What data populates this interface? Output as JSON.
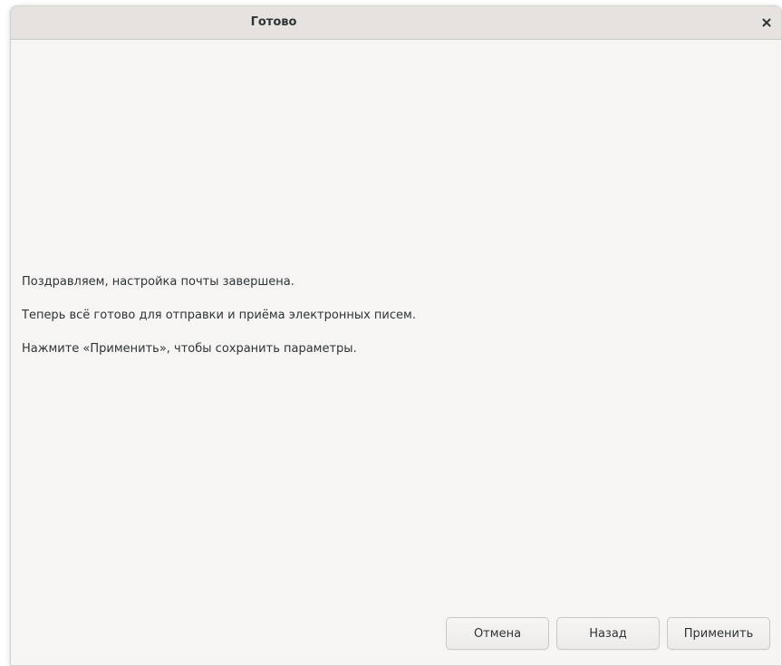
{
  "window": {
    "title": "Готово",
    "close_icon": "close-icon"
  },
  "content": {
    "line1": "Поздравляем, настройка почты завершена.",
    "line2": "Теперь всё готово для отправки и приёма электронных писем.",
    "line3": "Нажмите «Применить», чтобы сохранить параметры."
  },
  "buttons": {
    "cancel_label": "Отмена",
    "back_label": "Назад",
    "apply_label": "Применить"
  },
  "colors": {
    "background": "#f6f5f4",
    "titlebar": "#e5e2df",
    "text": "#2e3436",
    "border": "#cdc7c2"
  }
}
